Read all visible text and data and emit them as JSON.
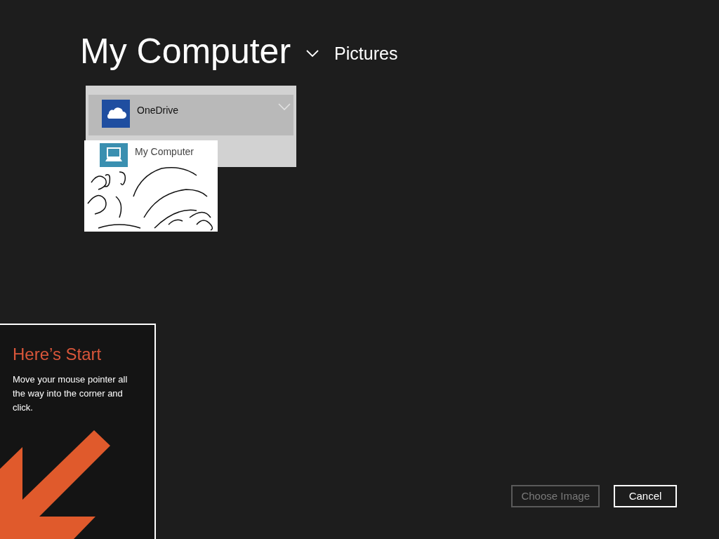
{
  "header": {
    "location": "My Computer",
    "folder": "Pictures"
  },
  "location_menu": {
    "items": [
      {
        "label": "OneDrive",
        "kind": "cloud",
        "selected": true
      },
      {
        "label": "My Computer",
        "kind": "computer",
        "selected": false
      }
    ]
  },
  "start_tip": {
    "title": "Here’s Start",
    "body": "Move your mouse pointer all the way into the corner and click."
  },
  "buttons": [
    {
      "label": "Choose Image",
      "disabled": true
    },
    {
      "label": "Cancel",
      "disabled": false
    }
  ]
}
